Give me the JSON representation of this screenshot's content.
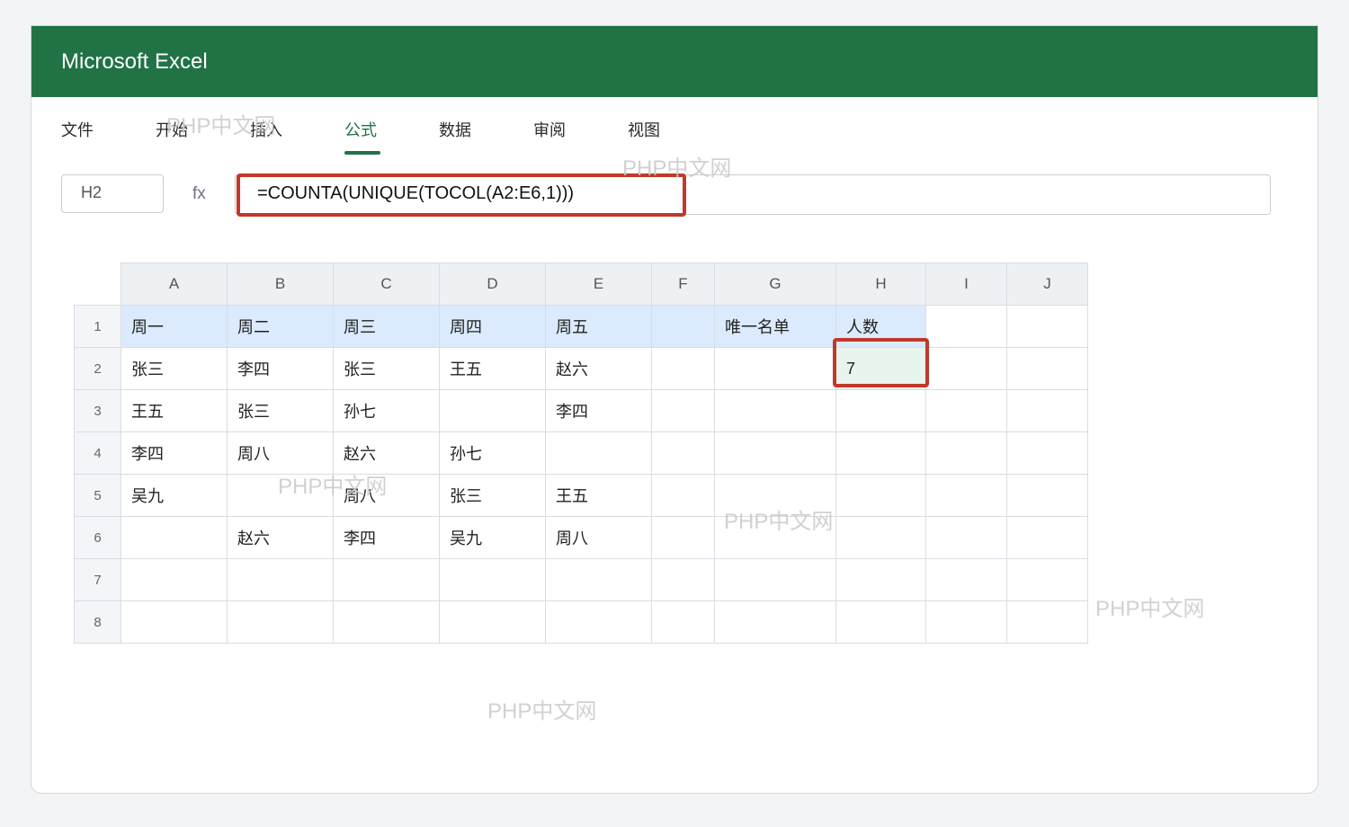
{
  "app": {
    "title": "Microsoft Excel"
  },
  "ribbon": {
    "tabs": [
      {
        "label": "文件"
      },
      {
        "label": "开始"
      },
      {
        "label": "插入"
      },
      {
        "label": "公式",
        "active": true
      },
      {
        "label": "数据"
      },
      {
        "label": "审阅"
      },
      {
        "label": "视图"
      }
    ]
  },
  "formula_bar": {
    "name_box": "H2",
    "fx_label": "fx",
    "formula": "=COUNTA(UNIQUE(TOCOL(A2:E6,1)))"
  },
  "sheet": {
    "columns": [
      "A",
      "B",
      "C",
      "D",
      "E",
      "F",
      "G",
      "H",
      "I",
      "J"
    ],
    "rows": [
      {
        "num": "1",
        "cells": [
          "周一",
          "周二",
          "周三",
          "周四",
          "周五",
          "",
          "唯一名单",
          "人数",
          "",
          ""
        ]
      },
      {
        "num": "2",
        "cells": [
          "张三",
          "李四",
          "张三",
          "王五",
          "赵六",
          "",
          "",
          "7",
          "",
          ""
        ]
      },
      {
        "num": "3",
        "cells": [
          "王五",
          "张三",
          "孙七",
          "",
          "李四",
          "",
          "",
          "",
          "",
          ""
        ]
      },
      {
        "num": "4",
        "cells": [
          "李四",
          "周八",
          "赵六",
          "孙七",
          "",
          "",
          "",
          "",
          "",
          ""
        ]
      },
      {
        "num": "5",
        "cells": [
          "吴九",
          "",
          "周八",
          "张三",
          "王五",
          "",
          "",
          "",
          "",
          ""
        ]
      },
      {
        "num": "6",
        "cells": [
          "",
          "赵六",
          "李四",
          "吴九",
          "周八",
          "",
          "",
          "",
          "",
          ""
        ]
      },
      {
        "num": "7",
        "cells": [
          "",
          "",
          "",
          "",
          "",
          "",
          "",
          "",
          "",
          ""
        ]
      },
      {
        "num": "8",
        "cells": [
          "",
          "",
          "",
          "",
          "",
          "",
          "",
          "",
          "",
          ""
        ]
      }
    ],
    "selected_cell": "H2"
  },
  "watermarks": [
    "PHP中文网",
    "PHP中文网",
    "PHP中文网",
    "PHP中文网",
    "PHP中文网",
    "PHP中文网"
  ],
  "colors": {
    "brand": "#217346",
    "highlight": "#c0392b",
    "header_fill": "#dbeafd",
    "selected_fill": "#e8f5ec"
  }
}
